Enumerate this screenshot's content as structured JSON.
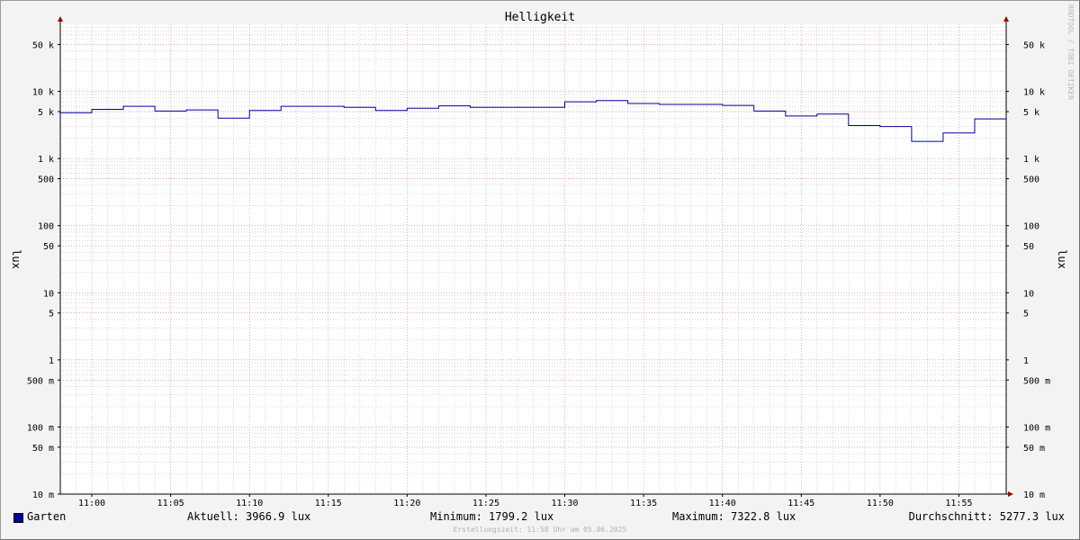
{
  "chart_data": {
    "type": "line",
    "title": "Helligkeit",
    "ylabel": "lux",
    "ylabel_right": "lux",
    "y_scale": "log",
    "ylim": [
      0.01,
      100000
    ],
    "xlim": [
      "10:58:00",
      "11:58:00"
    ],
    "x_ticks": [
      "11:00",
      "11:05",
      "11:10",
      "11:15",
      "11:20",
      "11:25",
      "11:30",
      "11:35",
      "11:40",
      "11:45",
      "11:50",
      "11:55"
    ],
    "y_ticks": [
      {
        "value": 50000,
        "label": "50 k"
      },
      {
        "value": 10000,
        "label": "10 k"
      },
      {
        "value": 5000,
        "label": "5 k"
      },
      {
        "value": 1000,
        "label": "1 k"
      },
      {
        "value": 500,
        "label": "500"
      },
      {
        "value": 100,
        "label": "100"
      },
      {
        "value": 50,
        "label": "50"
      },
      {
        "value": 10,
        "label": "10"
      },
      {
        "value": 5,
        "label": "5"
      },
      {
        "value": 1,
        "label": "1"
      },
      {
        "value": 0.5,
        "label": "500 m"
      },
      {
        "value": 0.1,
        "label": "100 m"
      },
      {
        "value": 0.05,
        "label": "50 m"
      },
      {
        "value": 0.01,
        "label": "10 m"
      }
    ],
    "grid": true,
    "series": [
      {
        "name": "Garten",
        "color": "#0000a0",
        "step": true,
        "points": [
          {
            "t": "10:58:00",
            "v": 4800
          },
          {
            "t": "11:00:00",
            "v": 5400
          },
          {
            "t": "11:02:00",
            "v": 6000
          },
          {
            "t": "11:04:00",
            "v": 5100
          },
          {
            "t": "11:06:00",
            "v": 5300
          },
          {
            "t": "11:08:00",
            "v": 4000
          },
          {
            "t": "11:10:00",
            "v": 5200
          },
          {
            "t": "11:12:00",
            "v": 6000
          },
          {
            "t": "11:16:00",
            "v": 5800
          },
          {
            "t": "11:18:00",
            "v": 5200
          },
          {
            "t": "11:20:00",
            "v": 5600
          },
          {
            "t": "11:22:00",
            "v": 6100
          },
          {
            "t": "11:24:00",
            "v": 5800
          },
          {
            "t": "11:30:00",
            "v": 7000
          },
          {
            "t": "11:32:00",
            "v": 7300
          },
          {
            "t": "11:34:00",
            "v": 6600
          },
          {
            "t": "11:36:00",
            "v": 6400
          },
          {
            "t": "11:40:00",
            "v": 6200
          },
          {
            "t": "11:42:00",
            "v": 5100
          },
          {
            "t": "11:44:00",
            "v": 4300
          },
          {
            "t": "11:46:00",
            "v": 4600
          },
          {
            "t": "11:48:00",
            "v": 3100
          },
          {
            "t": "11:50:00",
            "v": 3000
          },
          {
            "t": "11:52:00",
            "v": 1800
          },
          {
            "t": "11:54:00",
            "v": 2400
          },
          {
            "t": "11:56:00",
            "v": 3900
          },
          {
            "t": "11:58:00",
            "v": 3966.9
          }
        ]
      }
    ],
    "legend": {
      "name": "Garten",
      "current": "Aktuell: 3966.9 lux",
      "minimum": "Minimum: 1799.2 lux",
      "maximum": "Maximum: 7322.8 lux",
      "average": "Durchschnitt: 5277.3 lux"
    },
    "footer": "Erstellungszeit: 11:58 Uhr am 05.06.2025",
    "watermark": "RRDTOOL / TOBI OETIKER",
    "colors": {
      "series": "#0000a0",
      "major_grid": "#e07a7a",
      "minor_grid": "#b0b0b0",
      "axis_arrow": "#a00000",
      "background": "#f3f3f3",
      "plot_background": "#ffffff"
    }
  }
}
